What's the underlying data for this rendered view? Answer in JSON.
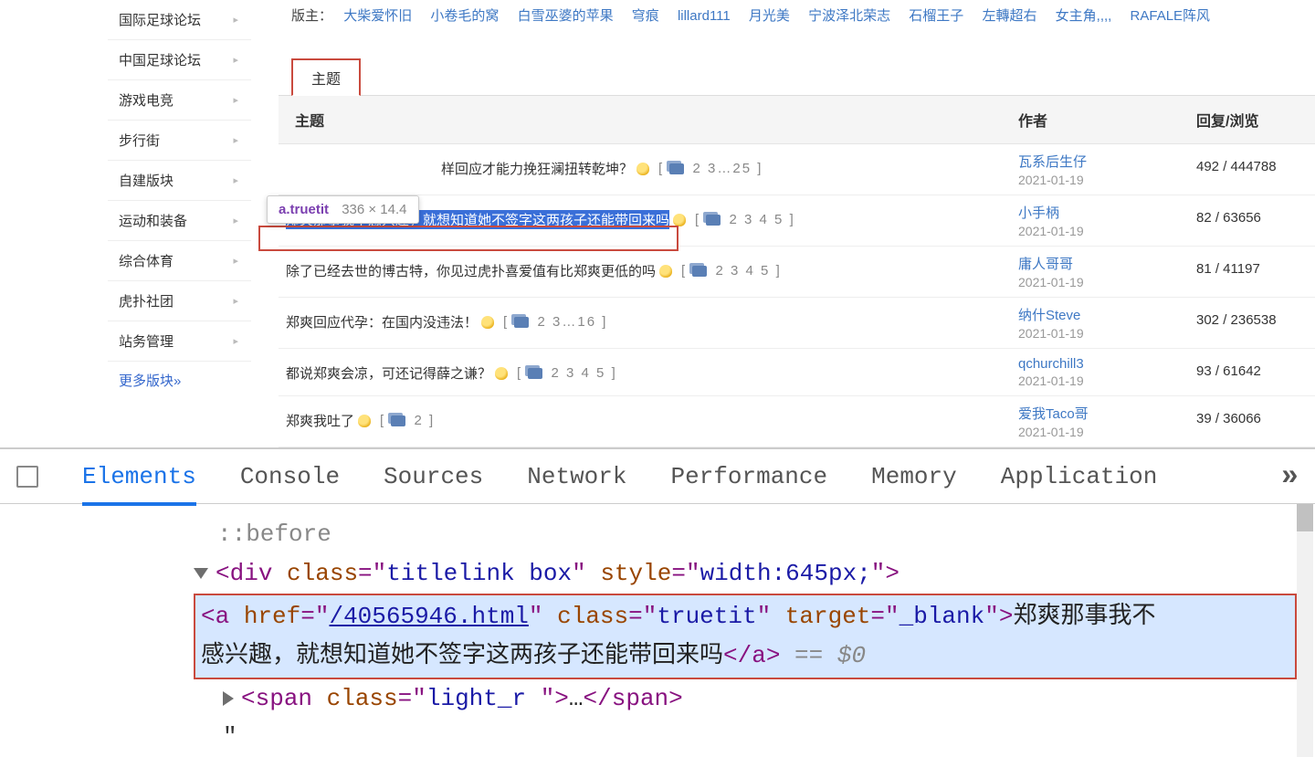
{
  "sidebar": {
    "items": [
      {
        "label": "国际足球论坛"
      },
      {
        "label": "中国足球论坛"
      },
      {
        "label": "游戏电竞"
      },
      {
        "label": "步行街"
      },
      {
        "label": "自建版块"
      },
      {
        "label": "运动和装备"
      },
      {
        "label": "综合体育"
      },
      {
        "label": "虎扑社团"
      },
      {
        "label": "站务管理"
      }
    ],
    "more": "更多版块»"
  },
  "mods": {
    "label": "版主：",
    "names": [
      "大柴爱怀旧",
      "小卷毛的窝",
      "白雪巫婆的苹果",
      "穹痕",
      "lillard111",
      "月光美",
      "宁波泽北荣志",
      "石榴王子",
      "左轉超右",
      "女主角,,,,",
      "RAFALE阵风"
    ]
  },
  "tab": "主题",
  "columns": {
    "title": "主题",
    "author": "作者",
    "reply": "回复/浏览"
  },
  "rows": [
    {
      "title": "样回应才能力挽狂澜扭转乾坤？",
      "pages": "2 3…25",
      "author": "瓦系后生仔",
      "date": "2021-01-19",
      "reply": "492 / 444788",
      "bulb": true,
      "highlighted": false
    },
    {
      "title": "郑爽那事我不感兴趣，就想知道她不签字这两孩子还能带回来吗",
      "pages": "2 3 4 5",
      "author": "小手柄",
      "date": "2021-01-19",
      "reply": "82 / 63656",
      "bulb": true,
      "highlighted": true
    },
    {
      "title": "除了已经去世的博古特，你见过虎扑喜爱值有比郑爽更低的吗",
      "pages": "2 3 4 5",
      "author": "庸人哥哥",
      "date": "2021-01-19",
      "reply": "81 / 41197",
      "bulb": true,
      "highlighted": false
    },
    {
      "title": "郑爽回应代孕：在国内没违法！",
      "pages": "2 3…16",
      "author": "纳什Steve",
      "date": "2021-01-19",
      "reply": "302 / 236538",
      "bulb": true,
      "highlighted": false
    },
    {
      "title": "都说郑爽会凉，可还记得薛之谦？",
      "pages": "2 3 4 5",
      "author": "qchurchill3",
      "date": "2021-01-19",
      "reply": "93 / 61642",
      "bulb": true,
      "highlighted": false
    },
    {
      "title": "郑爽我吐了",
      "pages": "2",
      "author": "爱我Taco哥",
      "date": "2021-01-19",
      "reply": "39 / 36066",
      "bulb": true,
      "highlighted": false
    }
  ],
  "tooltip": {
    "selector": "a.truetit",
    "dims": "336 × 14.4"
  },
  "devtools": {
    "tabs": [
      "Elements",
      "Console",
      "Sources",
      "Network",
      "Performance",
      "Memory",
      "Application"
    ],
    "active": 0,
    "more": "»",
    "code": {
      "pseudo": "::before",
      "div_open_1": "<",
      "div_tag": "div ",
      "class_attr": "class",
      "eq": "=",
      "q": "\"",
      "div_class": "titlelink box",
      "style_attr": " style",
      "div_style": "width:645px;",
      "close": ">",
      "a_tag": "a ",
      "href_attr": "href",
      "a_href": "/40565946.html",
      "a_class": "truetit",
      "target_attr": " target",
      "a_target": "_blank",
      "a_text1": "郑爽那事我不",
      "a_text2": "感兴趣，就想知道她不签字这两孩子还能带回来吗",
      "a_close_tag": "a",
      "eqzero": " == $0",
      "span_tag": "span ",
      "span_class": "light_r  ",
      "ellipsis": "…",
      "span_close": "span",
      "quote": "\""
    }
  }
}
